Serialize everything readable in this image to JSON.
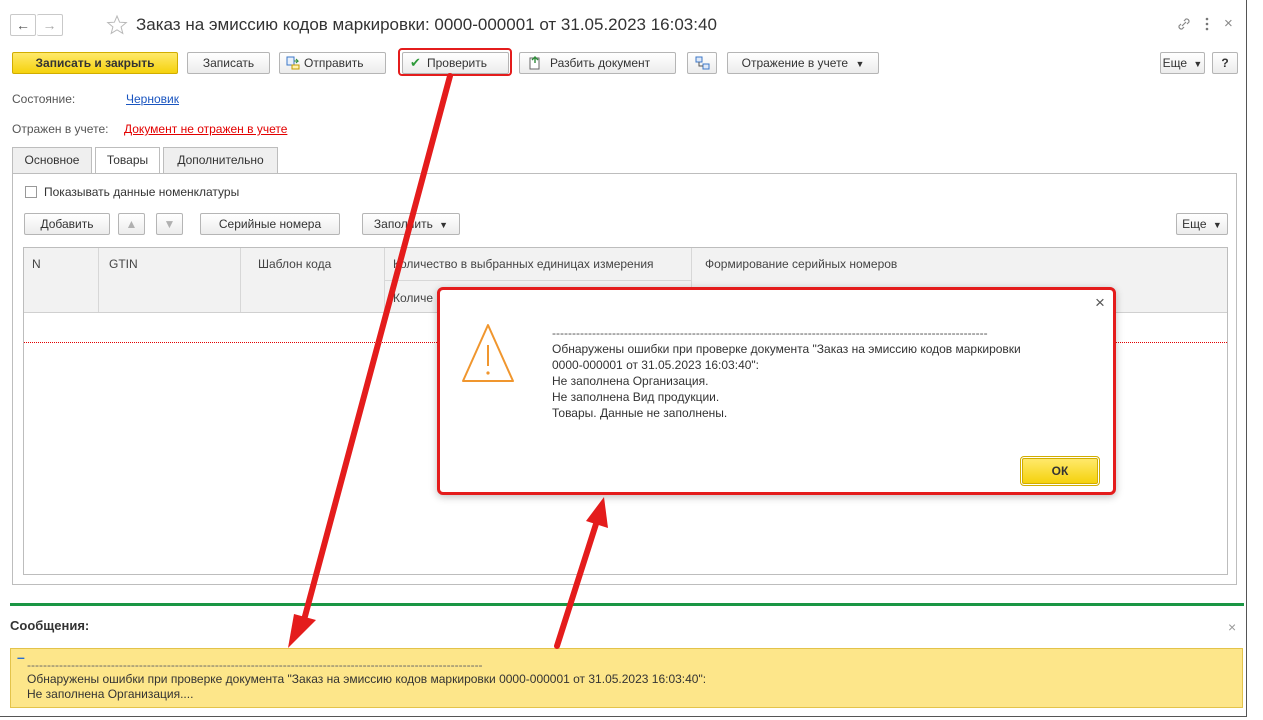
{
  "window": {
    "title": "Заказ на эмиссию кодов маркировки: 0000-000001 от 31.05.2023 16:03:40",
    "nav_back": "←",
    "nav_forward": "→"
  },
  "toolbar": {
    "save_close": "Записать и закрыть",
    "save": "Записать",
    "send": "Отправить",
    "check": "Проверить",
    "split": "Разбить документ",
    "accounting": "Отражение в учете",
    "more": "Еще",
    "help": "?"
  },
  "status": {
    "state_label": "Состояние:",
    "state_value": "Черновик",
    "accounting_label": "Отражен в учете:",
    "accounting_value": "Документ не отражен в учете"
  },
  "tabs": [
    "Основное",
    "Товары",
    "Дополнительно"
  ],
  "goods": {
    "show_nomenclature": "Показывать данные номенклатуры",
    "add": "Добавить",
    "serials": "Серийные номера",
    "fill": "Заполнить",
    "more": "Еще",
    "columns": {
      "n": "N",
      "gtin": "GTIN",
      "template": "Шаблон кода",
      "qty_units": "Количество в выбранных единицах измерения",
      "qty_sub": "Количе",
      "serial_gen": "Формирование серийных номеров"
    }
  },
  "dialog": {
    "lines": [
      "-------------------------------------------------------------------------------------------------------------",
      "Обнаружены ошибки при проверке документа \"Заказ на эмиссию кодов маркировки",
      "0000-000001 от 31.05.2023 16:03:40\":",
      "Не заполнена Организация.",
      "Не заполнена Вид продукции.",
      "Товары. Данные не заполнены."
    ],
    "ok": "ОК",
    "close": "×"
  },
  "messages": {
    "title": "Сообщения:",
    "close": "×",
    "collapse": "–",
    "lines": [
      "------------------------------------------------------------------------------------------------------------------",
      "Обнаружены ошибки при проверке документа \"Заказ на эмиссию кодов маркировки 0000-000001 от 31.05.2023 16:03:40\":",
      "Не заполнена Организация...."
    ]
  },
  "colors": {
    "accent_yellow": "#f5d20d",
    "link_blue": "#1a55c0",
    "error_red": "#e30000",
    "annotation_red": "#e41c1c",
    "green_divider": "#1a9644",
    "message_bg": "#fde68a"
  }
}
